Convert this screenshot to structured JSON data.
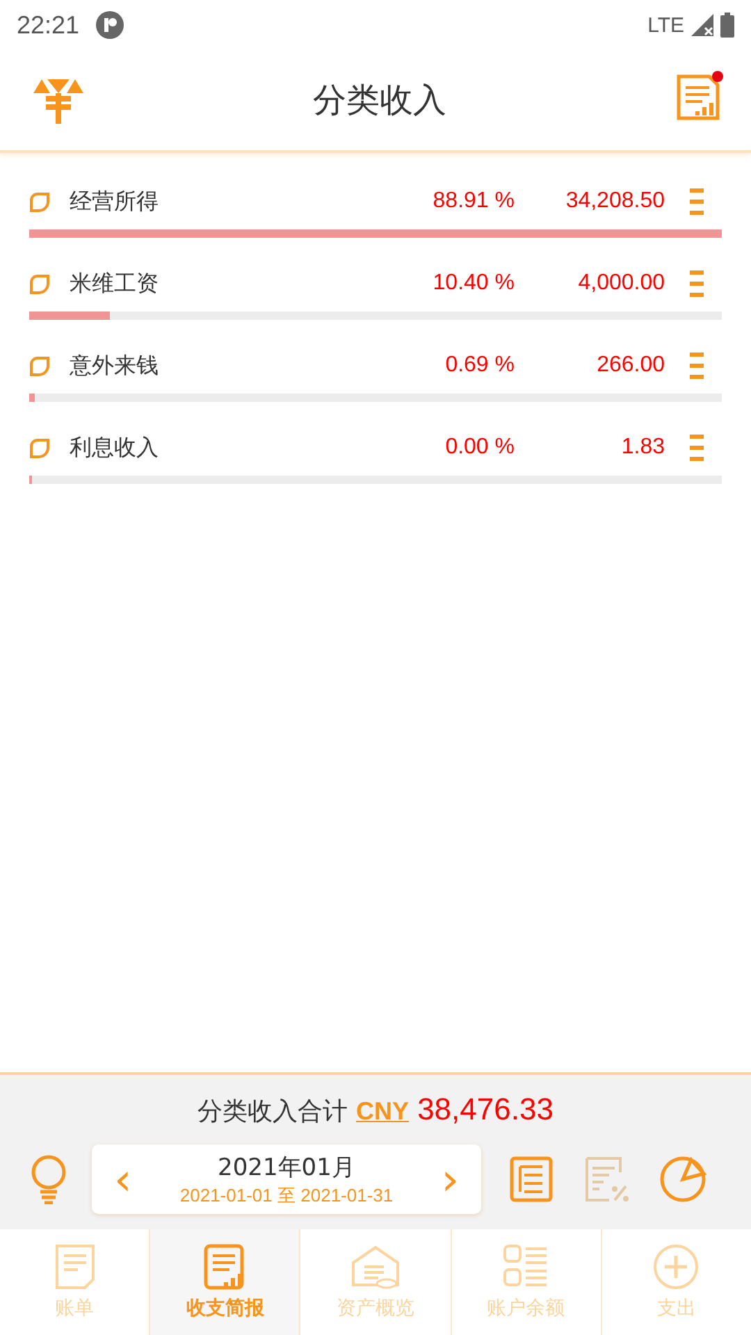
{
  "status_bar": {
    "time": "22:21",
    "network": "LTE"
  },
  "header": {
    "title": "分类收入",
    "notification": true
  },
  "categories": [
    {
      "name": "经营所得",
      "percent": "88.91 %",
      "amount": "34,208.50",
      "level": 1.0,
      "checked": false
    },
    {
      "name": "米维工资",
      "percent": "10.40 %",
      "amount": "4,000.00",
      "level": 0.117,
      "checked": false
    },
    {
      "name": "意外来钱",
      "percent": "0.69 %",
      "amount": "266.00",
      "level": 0.008,
      "checked": false
    },
    {
      "name": "利息收入",
      "percent": "0.00 %",
      "amount": "1.83",
      "level": 0.0,
      "checked": false
    }
  ],
  "summary": {
    "label": "分类收入合计",
    "currency": "CNY",
    "total": "38,476.33"
  },
  "period": {
    "month": "2021年01月",
    "start": "2021-01-01",
    "to": "至",
    "end": "2021-01-31",
    "prev": "‹",
    "next": "›"
  },
  "nav": [
    {
      "label": "账单",
      "kind": "bill",
      "selected": false
    },
    {
      "label": "收支简报",
      "kind": "report",
      "selected": true
    },
    {
      "label": "资产概览",
      "kind": "assets",
      "selected": false
    },
    {
      "label": "账户余额",
      "kind": "balance",
      "selected": false
    },
    {
      "label": "支出",
      "kind": "add",
      "selected": false
    }
  ]
}
